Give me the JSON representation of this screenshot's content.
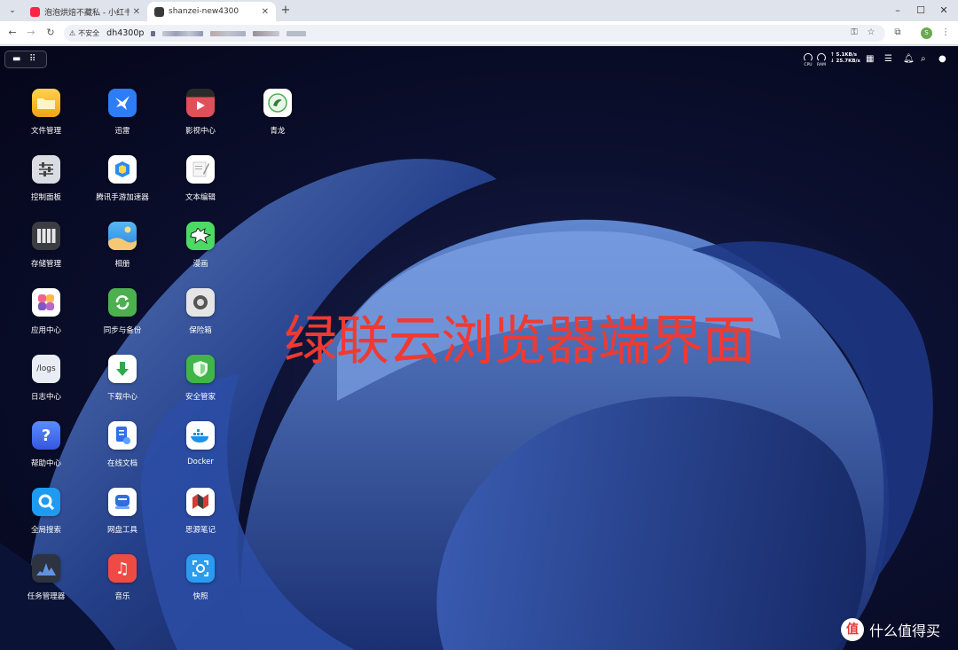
{
  "browser": {
    "tabs": [
      {
        "title": "泡泡烘焙不藏私 - 小红书",
        "active": false,
        "favicon_color": "#ff2442"
      },
      {
        "title": "shanzei-new4300",
        "active": true,
        "favicon_color": "#3a3a3a"
      }
    ],
    "security_label": "不安全",
    "url": "dh4300p",
    "window_controls": {
      "minimize": "–",
      "maximize": "☐",
      "close": "✕"
    }
  },
  "system_bar": {
    "cpu_label": "CPU",
    "ram_label": "RAM",
    "upload": "↑ 5.1KB/s",
    "download": "↓ 25.7KB/s"
  },
  "apps": [
    {
      "label": "文件管理",
      "icon": "folder-icon",
      "color": "#f5b62a"
    },
    {
      "label": "控制面板",
      "icon": "sliders-icon",
      "color": "#d9dde3"
    },
    {
      "label": "存储管理",
      "icon": "storage-icon",
      "color": "#3a3d42"
    },
    {
      "label": "应用中心",
      "icon": "app-center-icon",
      "color": "#ffffff"
    },
    {
      "label": "日志中心",
      "icon": "logs-icon",
      "color": "#e8edf5"
    },
    {
      "label": "帮助中心",
      "icon": "help-icon",
      "color": "#3f6df0"
    },
    {
      "label": "全局搜索",
      "icon": "search-icon",
      "color": "#1e9bf0"
    },
    {
      "label": "任务管理器",
      "icon": "task-manager-icon",
      "color": "#2d3340"
    },
    {
      "label": "迅雷",
      "icon": "thunder-bird-icon",
      "color": "#2e7cf6"
    },
    {
      "label": "腾讯手游加速器",
      "icon": "game-accelerator-icon",
      "color": "#ffffff"
    },
    {
      "label": "相册",
      "icon": "photo-album-icon",
      "color": "#4aa8f0"
    },
    {
      "label": "同步与备份",
      "icon": "sync-icon",
      "color": "#4cb04f"
    },
    {
      "label": "下载中心",
      "icon": "download-icon",
      "color": "#ffffff"
    },
    {
      "label": "在线文档",
      "icon": "online-docs-icon",
      "color": "#ffffff"
    },
    {
      "label": "网盘工具",
      "icon": "cloud-drive-icon",
      "color": "#ffffff"
    },
    {
      "label": "音乐",
      "icon": "music-icon",
      "color": "#ef4b45"
    },
    {
      "label": "影视中心",
      "icon": "video-icon",
      "color": "#e0505a"
    },
    {
      "label": "文本编辑",
      "icon": "text-editor-icon",
      "color": "#ffffff"
    },
    {
      "label": "漫画",
      "icon": "comic-icon",
      "color": "#4cd964"
    },
    {
      "label": "保险箱",
      "icon": "safe-icon",
      "color": "#e5e5e5"
    },
    {
      "label": "安全管家",
      "icon": "shield-icon",
      "color": "#3fb54a"
    },
    {
      "label": "Docker",
      "icon": "docker-icon",
      "color": "#ffffff"
    },
    {
      "label": "思源笔记",
      "icon": "siyuan-note-icon",
      "color": "#ffffff"
    },
    {
      "label": "快照",
      "icon": "snapshot-icon",
      "color": "#2a9cf0"
    },
    {
      "label": "青龙",
      "icon": "qinglong-icon",
      "color": "#ffffff"
    }
  ],
  "overlay_title": "绿联云浏览器端界面",
  "watermark": {
    "logo": "值",
    "text": "什么值得买"
  }
}
